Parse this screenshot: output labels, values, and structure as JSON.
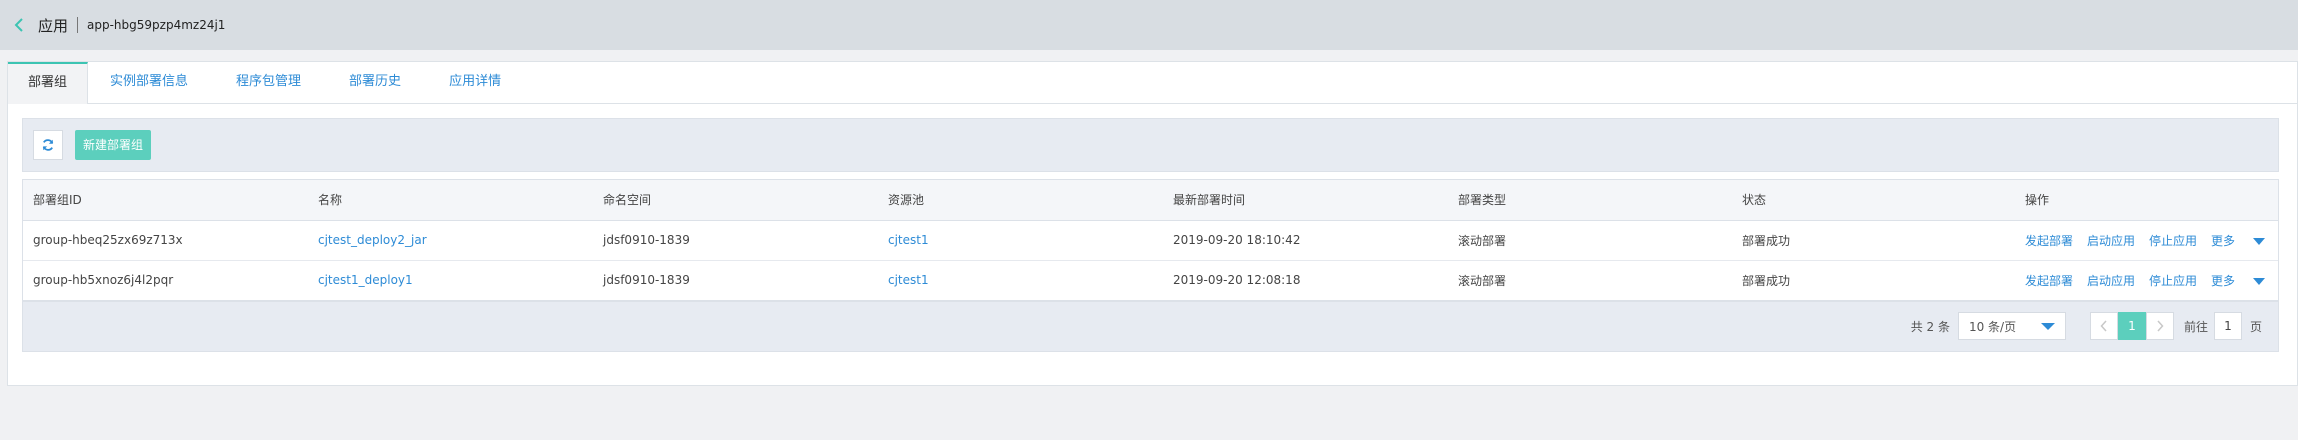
{
  "header": {
    "title": "应用",
    "app_id": "app-hbg59pzp4mz24j1"
  },
  "tabs": [
    {
      "label": "部署组",
      "active": true
    },
    {
      "label": "实例部署信息"
    },
    {
      "label": "程序包管理"
    },
    {
      "label": "部署历史"
    },
    {
      "label": "应用详情"
    }
  ],
  "toolbar": {
    "refresh_icon": "refresh-icon",
    "new_button": "新建部署组"
  },
  "table": {
    "columns": [
      "部署组ID",
      "名称",
      "命名空间",
      "资源池",
      "最新部署时间",
      "部署类型",
      "状态",
      "操作"
    ],
    "rows": [
      {
        "id": "group-hbeq25zx69z713x",
        "name": "cjtest_deploy2_jar",
        "namespace": "jdsf0910-1839",
        "pool": "cjtest1",
        "time": "2019-09-20 18:10:42",
        "type": "滚动部署",
        "status": "部署成功"
      },
      {
        "id": "group-hb5xnoz6j4l2pqr",
        "name": "cjtest1_deploy1",
        "namespace": "jdsf0910-1839",
        "pool": "cjtest1",
        "time": "2019-09-20 12:08:18",
        "type": "滚动部署",
        "status": "部署成功"
      }
    ],
    "actions": [
      "发起部署",
      "启动应用",
      "停止应用",
      "更多"
    ]
  },
  "pagination": {
    "total": "共 2 条",
    "page_size": "10 条/页",
    "current_page": "1",
    "goto_label": "前往",
    "goto_value": "1",
    "page_unit": "页"
  },
  "colors": {
    "accent": "#5ccfbd",
    "link": "#2d8bd6"
  }
}
